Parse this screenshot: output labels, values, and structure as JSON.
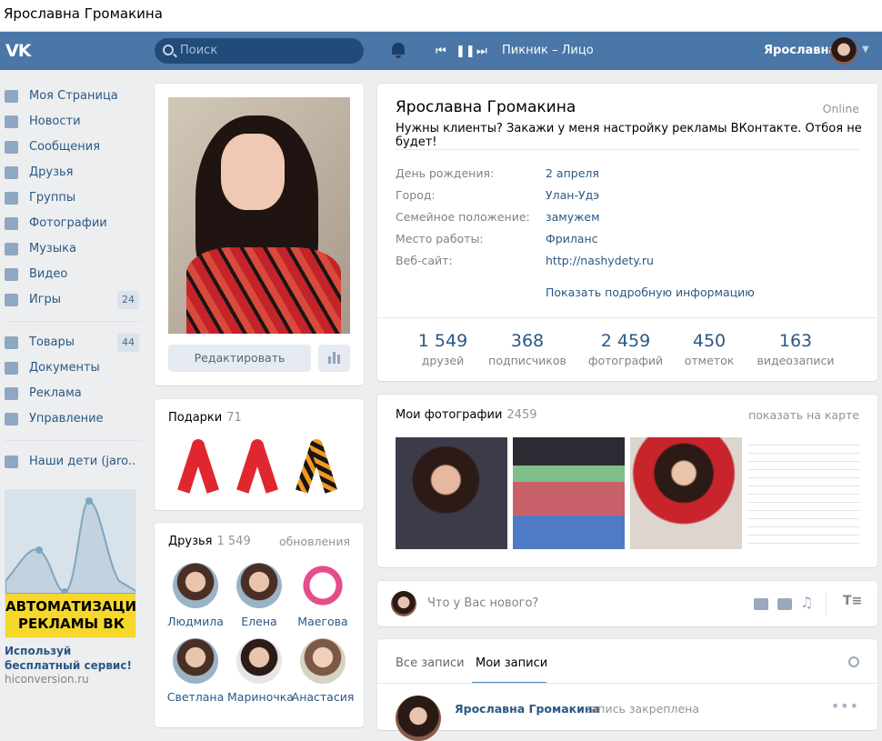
{
  "window": {
    "title": "Ярославна Громакина"
  },
  "header": {
    "logo": "VK",
    "search_placeholder": "Поиск",
    "now_playing": "Пикник – Лицо",
    "user_name": "Ярославна"
  },
  "sidebar": {
    "items": [
      {
        "label": "Моя Страница",
        "icon": "home-icon"
      },
      {
        "label": "Новости",
        "icon": "news-icon"
      },
      {
        "label": "Сообщения",
        "icon": "messages-icon"
      },
      {
        "label": "Друзья",
        "icon": "user-icon"
      },
      {
        "label": "Группы",
        "icon": "groups-icon"
      },
      {
        "label": "Фотографии",
        "icon": "camera-icon"
      },
      {
        "label": "Музыка",
        "icon": "music-icon"
      },
      {
        "label": "Видео",
        "icon": "video-icon"
      },
      {
        "label": "Игры",
        "icon": "gamepad-icon",
        "badge": "24"
      },
      {
        "label": "Товары",
        "icon": "bag-icon",
        "badge": "44"
      },
      {
        "label": "Документы",
        "icon": "document-icon"
      },
      {
        "label": "Реклама",
        "icon": "megaphone-icon"
      },
      {
        "label": "Управление",
        "icon": "gamepad-icon"
      },
      {
        "label": "Наши дети (jaro..",
        "icon": "groups-icon"
      }
    ]
  },
  "ad": {
    "banner_text": "АВТОМАТИЗАЦИЯ РЕКЛАМЫ ВК",
    "caption": "Используй бесплатный сервис!",
    "url": "hiconversion.ru"
  },
  "profile": {
    "edit_label": "Редактировать",
    "name": "Ярославна Громакина",
    "online": "Online",
    "status": "Нужны клиенты? Закажи у меня настройку рекламы ВКонтакте. Отбоя не будет!",
    "info": [
      {
        "key": "День рождения:",
        "value": "2 апреля"
      },
      {
        "key": "Город:",
        "value": "Улан-Удэ"
      },
      {
        "key": "Семейное положение:",
        "value": "замужем"
      },
      {
        "key": "Место работы:",
        "value": "Фриланс"
      },
      {
        "key": "Веб-сайт:",
        "value": "http://nashydety.ru"
      }
    ],
    "more_info": "Показать подробную информацию",
    "counters": [
      {
        "n": "1 549",
        "l": "друзей"
      },
      {
        "n": "368",
        "l": "подписчиков"
      },
      {
        "n": "2 459",
        "l": "фотографий"
      },
      {
        "n": "450",
        "l": "отметок"
      },
      {
        "n": "163",
        "l": "видеозаписи"
      }
    ]
  },
  "gifts": {
    "title": "Подарки",
    "count": "71"
  },
  "friends": {
    "title": "Друзья",
    "count": "1 549",
    "updates": "обновления",
    "list": [
      "Людмила",
      "Елена",
      "Маегова",
      "Светлана",
      "Мариночка",
      "Анастасия"
    ]
  },
  "photos": {
    "title": "Мои фотографии",
    "count": "2459",
    "map_link": "показать на карте"
  },
  "composer": {
    "placeholder": "Что у Вас нового?"
  },
  "wall": {
    "tabs": [
      "Все записи",
      "Мои записи"
    ],
    "post_author": "Ярославна Громакина",
    "post_note": "запись закреплена"
  }
}
